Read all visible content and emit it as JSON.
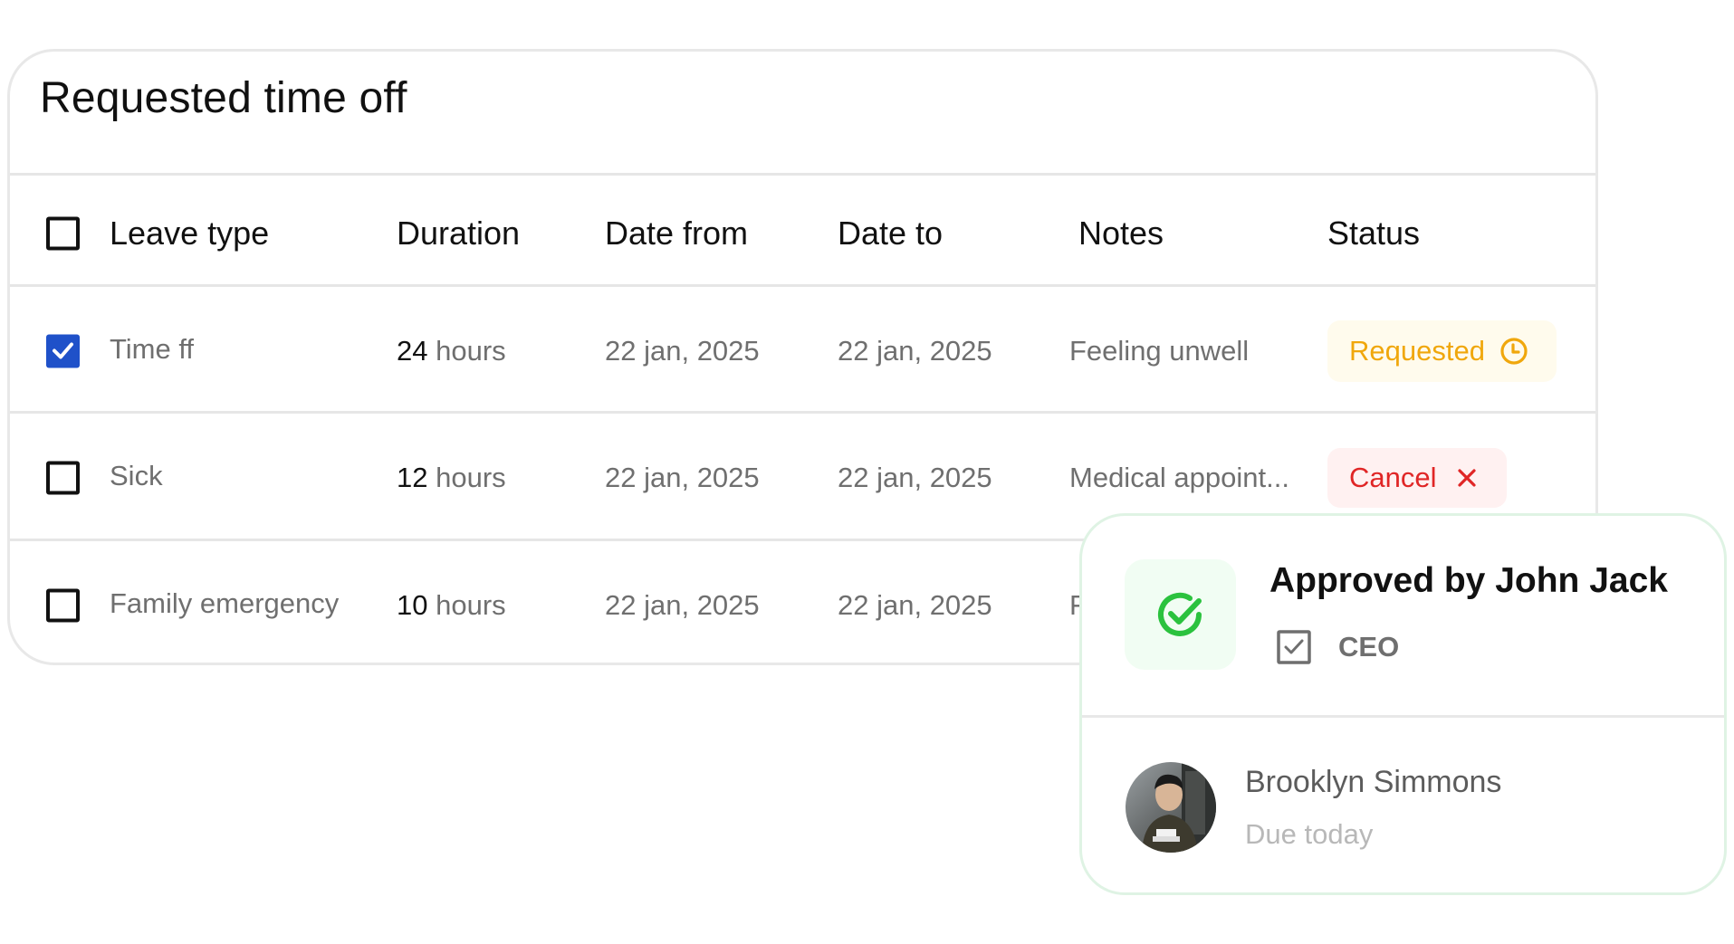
{
  "card": {
    "title": "Requested time off",
    "columns": [
      "Leave type",
      "Duration",
      "Date from",
      "Date to",
      "Notes",
      "Status"
    ],
    "rows": [
      {
        "checked": true,
        "leave_type": "Time ff",
        "duration_num": "24",
        "duration_unit": "hours",
        "date_from": "22 jan, 2025",
        "date_to": "22 jan, 2025",
        "notes": "Feeling unwell",
        "status": "Requested",
        "status_icon": "clock-icon",
        "status_color": "#f0a70c"
      },
      {
        "checked": false,
        "leave_type": "Sick",
        "duration_num": "12",
        "duration_unit": "hours",
        "date_from": "22 jan, 2025",
        "date_to": "22 jan, 2025",
        "notes": "Medical appoint...",
        "status": "Cancel",
        "status_icon": "x-icon",
        "status_color": "#e02626"
      },
      {
        "checked": false,
        "leave_type": "Family emergency",
        "duration_num": "10",
        "duration_unit": "hours",
        "date_from": "22 jan, 2025",
        "date_to": "22 jan, 2025",
        "notes": "F"
      }
    ]
  },
  "approval": {
    "title": "Approved by John Jack",
    "role": "CEO",
    "status_icon": "check-circle-icon",
    "accent": "#2bc23e",
    "assignee": {
      "name": "Brooklyn Simmons",
      "due": "Due today"
    }
  },
  "colors": {
    "checkbox_checked": "#1f51c9",
    "requested_bg": "#fffbed",
    "cancel_bg": "#fff1f1"
  }
}
